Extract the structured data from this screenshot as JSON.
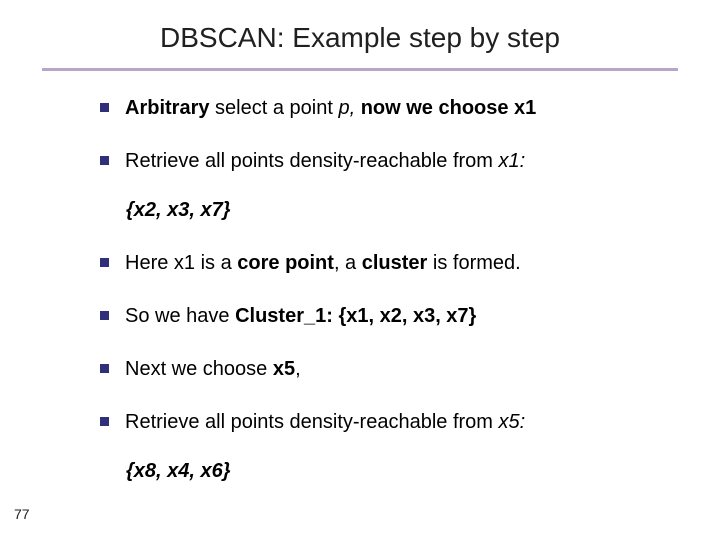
{
  "title": "DBSCAN: Example step by step",
  "bullets": {
    "b1": {
      "pre": "Arbitrary ",
      "mid": "select a point ",
      "p": "p,",
      "tail": " now we choose x1"
    },
    "b2": {
      "pre": "Retrieve all points density-reachable from ",
      "tail": "x1:"
    },
    "set1": "{x2, x3, x7}",
    "b3": {
      "a": "Here x1 is a ",
      "b": "core point",
      "c": ", a ",
      "d": "cluster",
      "e": " is formed."
    },
    "b4": {
      "a": "So we have ",
      "b": "Cluster_1: {x1, x2, x3, x7}"
    },
    "b5": {
      "a": "Next we choose ",
      "b": "x5",
      "c": ","
    },
    "b6": {
      "a": "Retrieve all points density-reachable from ",
      "b": "x5:"
    },
    "set2": "{x8, x4, x6}"
  },
  "page": "77"
}
